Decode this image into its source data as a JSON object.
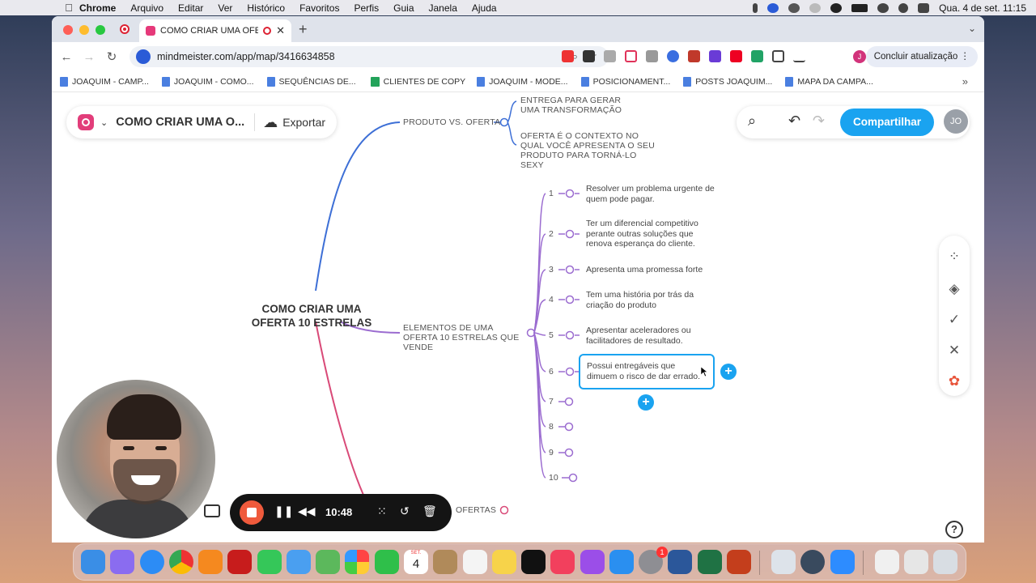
{
  "menubar": {
    "app": "Chrome",
    "items": [
      "Arquivo",
      "Editar",
      "Ver",
      "Histórico",
      "Favoritos",
      "Perfis",
      "Guia",
      "Janela",
      "Ajuda"
    ],
    "clock": "Qua. 4 de set.  11:15"
  },
  "browser": {
    "tab_title": "COMO CRIAR UMA OFERT",
    "url": "mindmeister.com/app/map/3416634858",
    "update_label": "Concluir atualização",
    "profile_initial": "J",
    "bookmarks": [
      {
        "label": "JOAQUIM - CAMP...",
        "kind": "doc"
      },
      {
        "label": "JOAQUIM - COMO...",
        "kind": "doc"
      },
      {
        "label": "SEQUÊNCIAS DE...",
        "kind": "doc"
      },
      {
        "label": "CLIENTES DE COPY",
        "kind": "sheet"
      },
      {
        "label": "JOAQUIM - MODE...",
        "kind": "doc"
      },
      {
        "label": "POSICIONAMENT...",
        "kind": "doc"
      },
      {
        "label": "POSTS JOAQUIM...",
        "kind": "doc"
      },
      {
        "label": "MAPA DA CAMPA...",
        "kind": "doc"
      }
    ]
  },
  "app": {
    "map_title": "COMO CRIAR UMA O...",
    "export_label": "Exportar",
    "share_label": "Compartilhar",
    "user_initials": "JO"
  },
  "map": {
    "root": "COMO CRIAR UMA OFERTA 10 ESTRELAS",
    "branch_produto": "PRODUTO VS. OFERTA",
    "produto_children": [
      "ENTREGA PARA GERAR UMA TRANSFORMAÇÃO",
      "OFERTA É O CONTEXTO NO QUAL VOCÊ APRESENTA O SEU PRODUTO PARA TORNÁ-LO SEXY"
    ],
    "branch_elementos": "ELEMENTOS DE UMA OFERTA 10 ESTRELAS QUE VENDE",
    "elementos": [
      {
        "n": "1",
        "text": "Resolver um problema urgente de quem pode pagar."
      },
      {
        "n": "2",
        "text": "Ter um diferencial competitivo perante outras soluções que renova esperança do cliente."
      },
      {
        "n": "3",
        "text": "Apresenta uma promessa forte"
      },
      {
        "n": "4",
        "text": "Tem uma história por trás da criação do produto"
      },
      {
        "n": "5",
        "text": "Apresentar aceleradores ou facilitadores de resultado."
      },
      {
        "n": "6",
        "text": "Possui entregáveis que dimuem o risco de dar errado."
      },
      {
        "n": "7",
        "text": ""
      },
      {
        "n": "8",
        "text": ""
      },
      {
        "n": "9",
        "text": ""
      },
      {
        "n": "10",
        "text": ""
      }
    ],
    "branch_bottom_partial": "OFERTAS"
  },
  "recorder": {
    "time": "10:48"
  },
  "dock": {
    "calendar_month": "SET.",
    "calendar_day": "4",
    "badge_settings": "1"
  },
  "colors": {
    "accent": "#1aa3f0",
    "branch_blue": "#3d6fd6",
    "branch_purple": "#9b6cd0",
    "branch_red": "#d94a78",
    "logo_pink": "#e23d7a"
  }
}
